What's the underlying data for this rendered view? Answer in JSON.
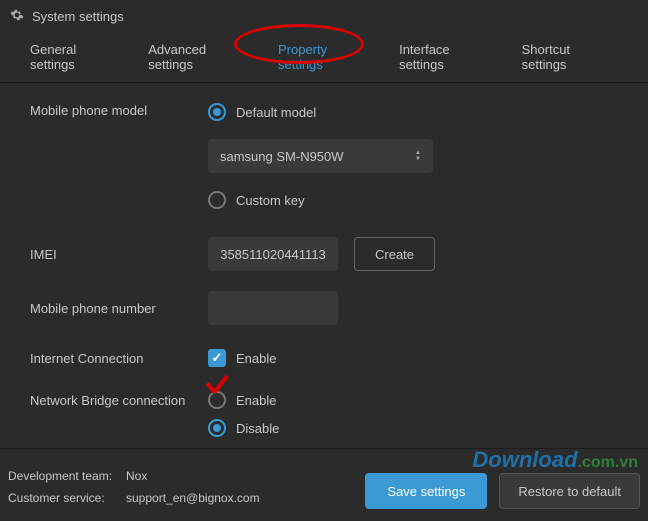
{
  "window": {
    "title": "System settings"
  },
  "tabs": [
    {
      "label": "General settings",
      "active": false
    },
    {
      "label": "Advanced settings",
      "active": false
    },
    {
      "label": "Property settings",
      "active": true
    },
    {
      "label": "Interface settings",
      "active": false
    },
    {
      "label": "Shortcut settings",
      "active": false
    }
  ],
  "fields": {
    "model": {
      "label": "Mobile phone model",
      "option_default": "Default model",
      "option_custom": "Custom key",
      "selected": "default",
      "dropdown_value": "samsung SM-N950W"
    },
    "imei": {
      "label": "IMEI",
      "value": "358511020441113",
      "create_button": "Create"
    },
    "phone": {
      "label": "Mobile phone number",
      "value": ""
    },
    "internet": {
      "label": "Internet Connection",
      "enable_text": "Enable",
      "checked": true
    },
    "bridge": {
      "label": "Network Bridge connection",
      "enable_text": "Enable",
      "disable_text": "Disable",
      "selected": "disable"
    }
  },
  "footer": {
    "dev_label": "Development team:",
    "dev_value": "Nox",
    "cs_label": "Customer service:",
    "cs_value": "support_en@bignox.com",
    "save": "Save settings",
    "restore": "Restore to default"
  },
  "watermark": {
    "main": "Download",
    "suffix": ".com.vn"
  }
}
